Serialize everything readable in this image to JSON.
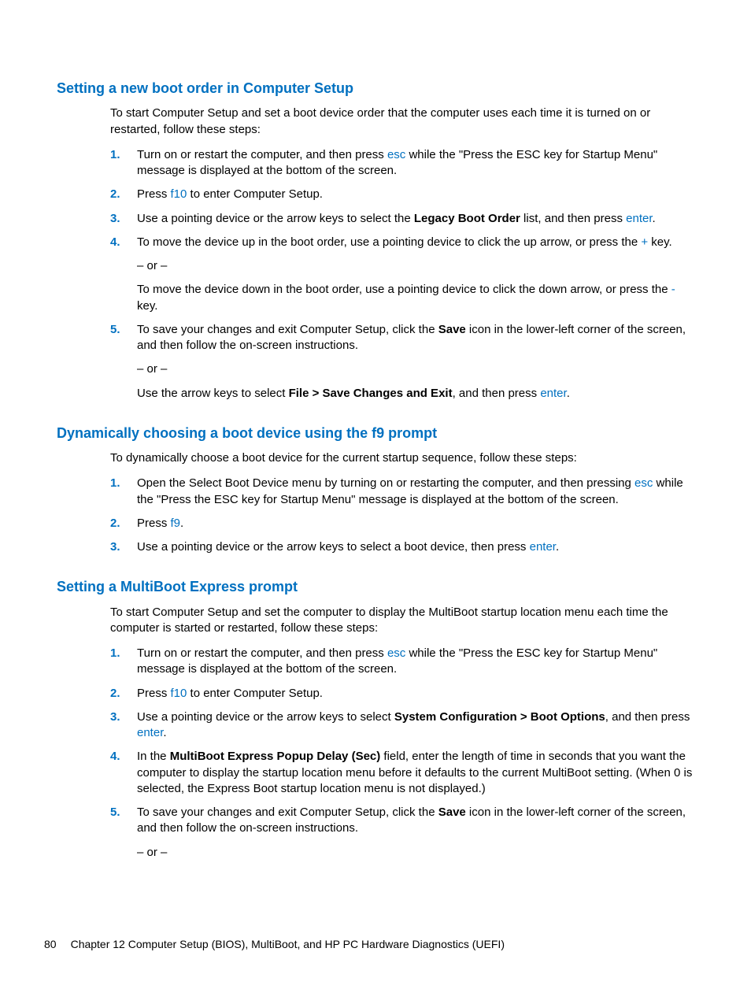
{
  "sections": [
    {
      "heading": "Setting a new boot order in Computer Setup",
      "intro": "To start Computer Setup and set a boot device order that the computer uses each time it is turned on or restarted, follow these steps:",
      "steps": [
        {
          "n": "1.",
          "t1a": "Turn on or restart the computer, and then press ",
          "k1": "esc",
          "t1b": " while the \"Press the ESC key for Startup Menu\" message is displayed at the bottom of the screen."
        },
        {
          "n": "2.",
          "t2a": "Press ",
          "k2": "f10",
          "t2b": " to enter Computer Setup."
        },
        {
          "n": "3.",
          "t3a": "Use a pointing device or the arrow keys to select the ",
          "b3": "Legacy Boot Order",
          "t3b": " list, and then press ",
          "k3": "enter",
          "t3c": "."
        },
        {
          "n": "4.",
          "t4a": "To move the device up in the boot order, use a pointing device to click the up arrow, or press the ",
          "k4a": "+",
          "t4b": " key.",
          "or": "– or –",
          "t4c": "To move the device down in the boot order, use a pointing device to click the down arrow, or press the ",
          "k4b": "-",
          "t4d": " key."
        },
        {
          "n": "5.",
          "t5a": "To save your changes and exit Computer Setup, click the ",
          "b5a": "Save",
          "t5b": " icon in the lower-left corner of the screen, and then follow the on-screen instructions.",
          "or": "– or –",
          "t5c": "Use the arrow keys to select ",
          "b5b": "File > Save Changes and Exit",
          "t5d": ", and then press ",
          "k5": "enter",
          "t5e": "."
        }
      ]
    },
    {
      "heading": "Dynamically choosing a boot device using the f9 prompt",
      "intro": "To dynamically choose a boot device for the current startup sequence, follow these steps:",
      "steps": [
        {
          "n": "1.",
          "ta": "Open the Select Boot Device menu by turning on or restarting the computer, and then pressing ",
          "k": "esc",
          "tb": " while the \"Press the ESC key for Startup Menu\" message is displayed at the bottom of the screen."
        },
        {
          "n": "2.",
          "ta": "Press ",
          "k": "f9",
          "tb": "."
        },
        {
          "n": "3.",
          "ta": "Use a pointing device or the arrow keys to select a boot device, then press ",
          "k": "enter",
          "tb": "."
        }
      ]
    },
    {
      "heading": "Setting a MultiBoot Express prompt",
      "intro": "To start Computer Setup and set the computer to display the MultiBoot startup location menu each time the computer is started or restarted, follow these steps:",
      "steps": [
        {
          "n": "1.",
          "ta": "Turn on or restart the computer, and then press ",
          "k": "esc",
          "tb": " while the \"Press the ESC key for Startup Menu\" message is displayed at the bottom of the screen."
        },
        {
          "n": "2.",
          "ta": "Press ",
          "k": "f10",
          "tb": " to enter Computer Setup."
        },
        {
          "n": "3.",
          "ta": "Use a pointing device or the arrow keys to select ",
          "b": "System Configuration > Boot Options",
          "tb": ", and then press ",
          "k": "enter",
          "tc": "."
        },
        {
          "n": "4.",
          "ta": "In the ",
          "b": "MultiBoot Express Popup Delay (Sec)",
          "tb": " field, enter the length of time in seconds that you want the computer to display the startup location menu before it defaults to the current MultiBoot setting. (When 0 is selected, the Express Boot startup location menu is not displayed.)"
        },
        {
          "n": "5.",
          "ta": "To save your changes and exit Computer Setup, click the ",
          "b": "Save",
          "tb": " icon in the lower-left corner of the screen, and then follow the on-screen instructions.",
          "or": "– or –"
        }
      ]
    }
  ],
  "footer": {
    "page": "80",
    "chapter": "Chapter 12   Computer Setup (BIOS), MultiBoot, and HP PC Hardware Diagnostics (UEFI)"
  }
}
